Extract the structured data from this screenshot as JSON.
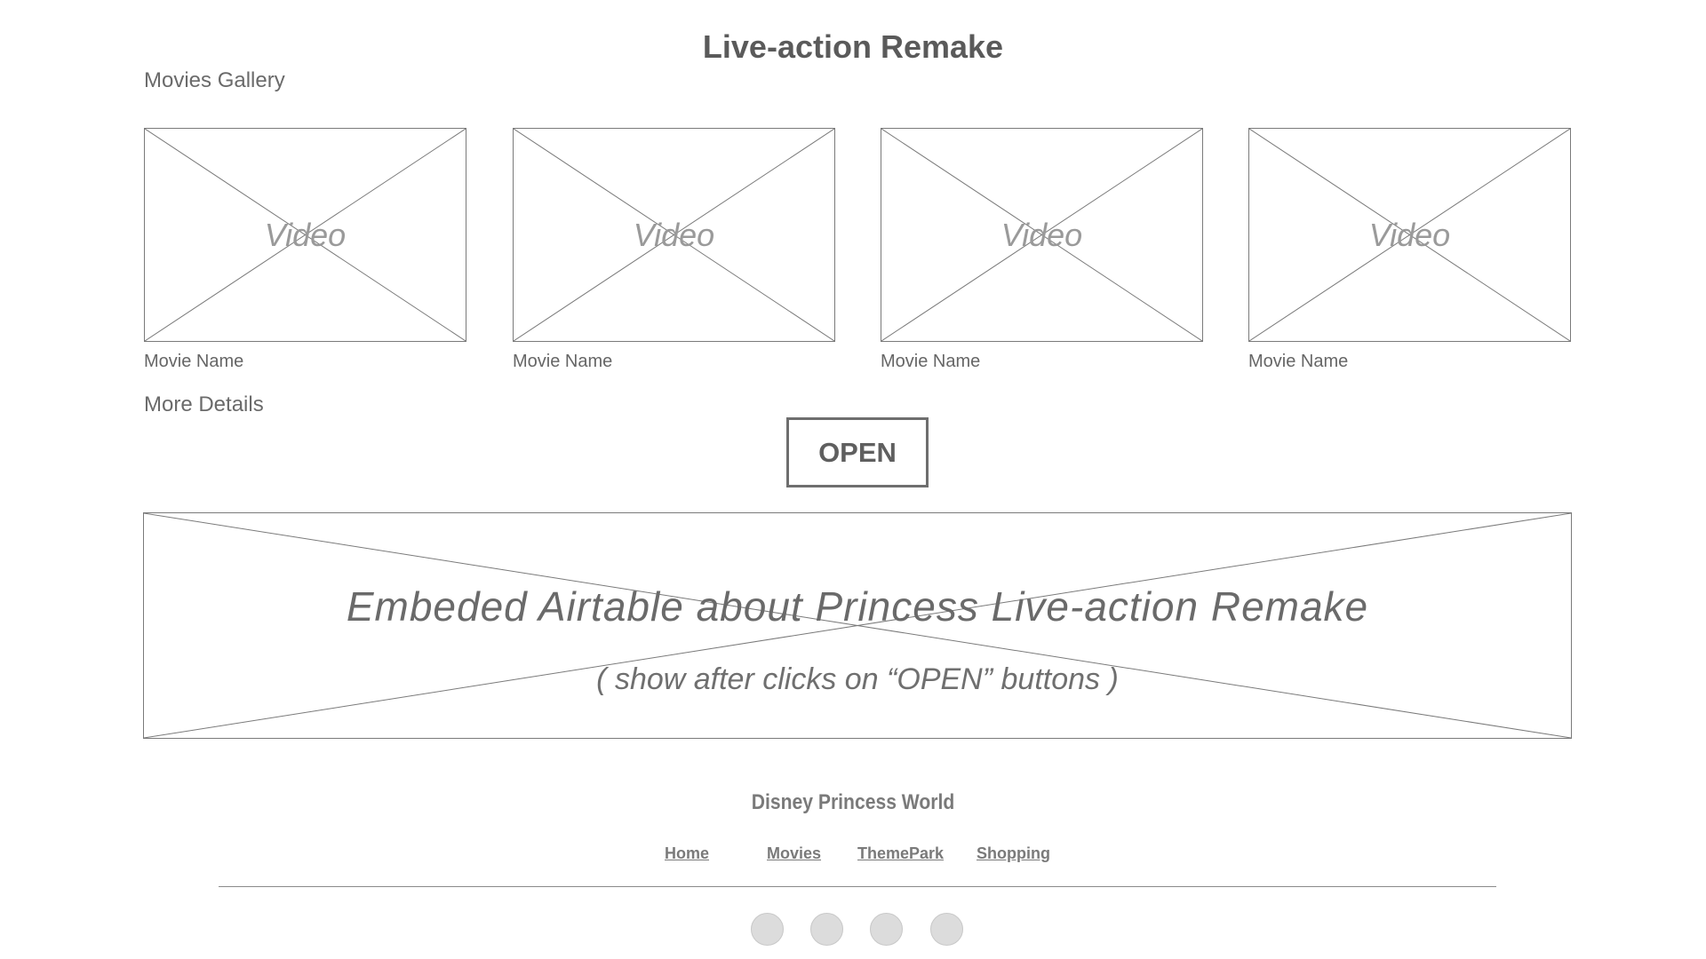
{
  "header": {
    "title": "Live-action Remake"
  },
  "gallery": {
    "section_label": "Movies Gallery",
    "cards": [
      {
        "placeholder": "Video",
        "name": "Movie Name"
      },
      {
        "placeholder": "Video",
        "name": "Movie Name"
      },
      {
        "placeholder": "Video",
        "name": "Movie Name"
      },
      {
        "placeholder": "Video",
        "name": "Movie Name"
      }
    ]
  },
  "details": {
    "section_label": "More Details",
    "open_label": "OPEN"
  },
  "airtable": {
    "headline": "Embeded Airtable about Princess Live-action Remake",
    "subline": "( show after clicks on “OPEN” buttons )"
  },
  "footer": {
    "brand": "Disney Princess World",
    "nav": [
      "Home",
      "Movies",
      "ThemePark",
      "Shopping"
    ],
    "social_icons": [
      "social-circle",
      "social-circle",
      "social-circle",
      "social-circle"
    ]
  }
}
